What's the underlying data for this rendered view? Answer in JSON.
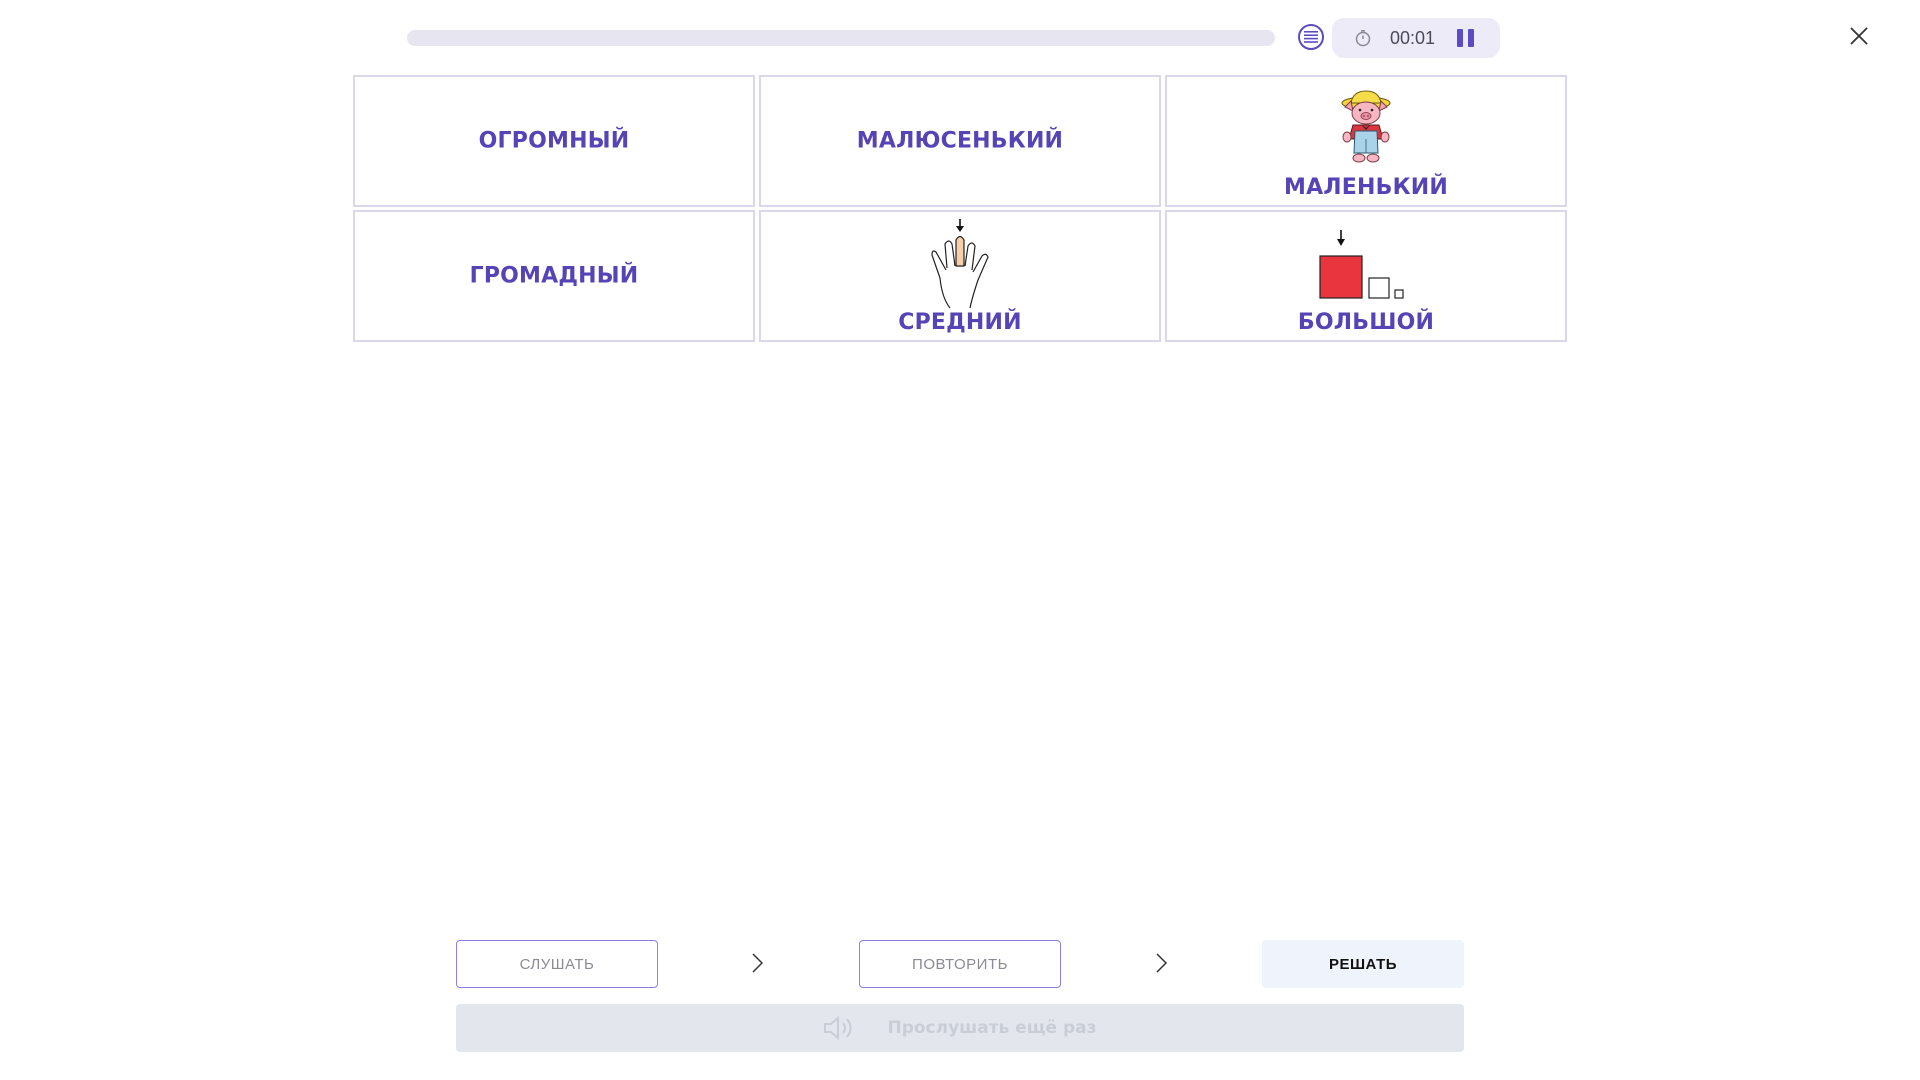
{
  "top_bar": {
    "progress": 0.0,
    "timer": "00:01",
    "icons": [
      "list-icon",
      "stopwatch-icon",
      "pause-icon",
      "close-icon"
    ]
  },
  "cards": [
    {
      "word": "ОГРОМНЫЙ",
      "image": null
    },
    {
      "word": "МАЛЮСЕНЬКИЙ",
      "image": null
    },
    {
      "word": "МАЛЕНЬКИЙ",
      "image": "pig-illustration"
    },
    {
      "word": "ГРОМАДНЫЙ",
      "image": null
    },
    {
      "word": "СРЕДНИЙ",
      "image": "hand-middle-finger-illustration"
    },
    {
      "word": "БОЛЬШОЙ",
      "image": "large-square-illustration"
    }
  ],
  "steps": {
    "listen": "СЛУШАТЬ",
    "repeat": "ПОВТОРИТЬ",
    "solve": "РЕШАТЬ"
  },
  "listen_again": "Прослушать ещё раз",
  "colors": {
    "accent": "#5643b5",
    "card_border": "#d9d7ea",
    "square_red": "#e8353e"
  }
}
